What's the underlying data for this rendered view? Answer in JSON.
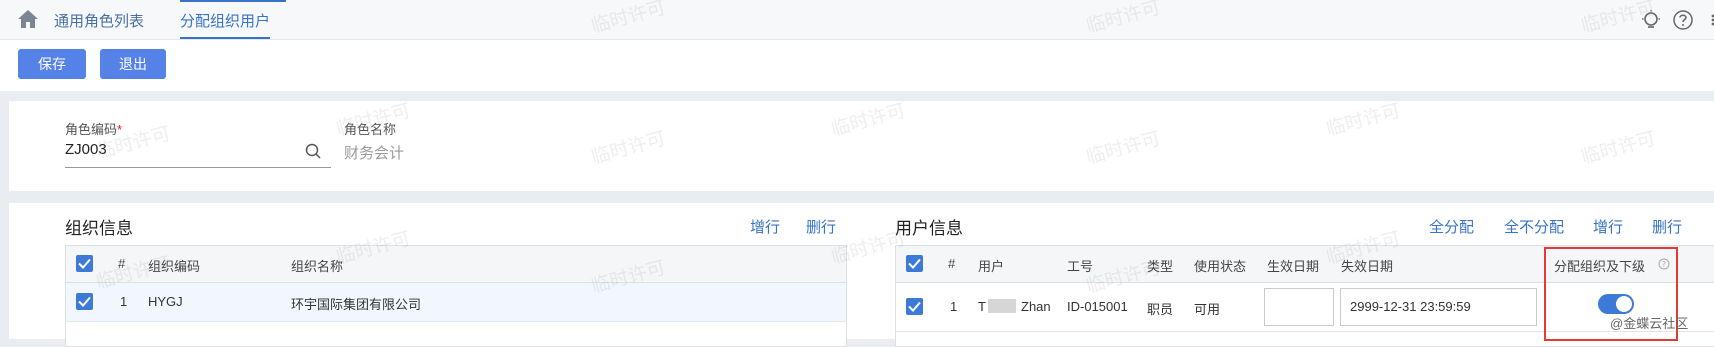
{
  "tabs": [
    {
      "label": "通用角色列表"
    },
    {
      "label": "分配组织用户"
    }
  ],
  "toolbar": {
    "save_label": "保存",
    "exit_label": "退出"
  },
  "role": {
    "code_label": "角色编码",
    "required_mark": "*",
    "code_value": "ZJ003",
    "name_label": "角色名称",
    "name_value": "财务会计"
  },
  "org": {
    "title": "组织信息",
    "add_row": "增行",
    "delete_row": "删行",
    "columns": {
      "index": "#",
      "code": "组织编码",
      "name": "组织名称"
    },
    "rows": [
      {
        "index": "1",
        "code": "HYGJ",
        "name": "环宇国际集团有限公司"
      }
    ]
  },
  "users": {
    "title": "用户信息",
    "assign_all": "全分配",
    "assign_none": "全不分配",
    "add_row": "增行",
    "delete_row": "删行",
    "columns": {
      "index": "#",
      "user": "用户",
      "job_no": "工号",
      "type": "类型",
      "status": "使用状态",
      "start_date": "生效日期",
      "end_date": "失效日期",
      "assign_sub": "分配组织及下级"
    },
    "rows": [
      {
        "index": "1",
        "user_first": "T",
        "user_last": "Zhan",
        "job_no": "ID-015001",
        "type": "职员",
        "status": "可用",
        "start_date": "",
        "end_date": "2999-12-31 23:59:59",
        "assign_sub": true
      }
    ]
  },
  "watermark": "临时许可",
  "community_tag": "@金蝶云社区",
  "colors": {
    "accent": "#3773c6",
    "button": "#5582e6",
    "highlight_border": "#e53935"
  }
}
